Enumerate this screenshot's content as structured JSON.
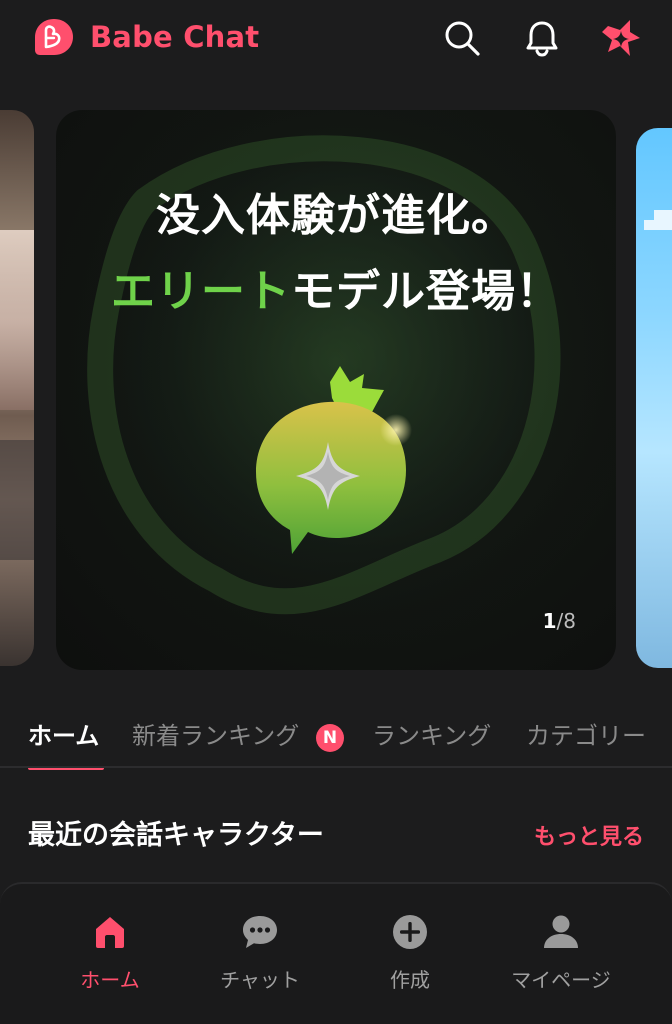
{
  "header": {
    "app_title": "Babe Chat",
    "logo_icon": "babe-chat-logo-icon",
    "search_icon": "search-icon",
    "notification_icon": "bell-icon",
    "elite_icon": "elite-sparkle-icon",
    "brand_color": "#ff4f6d"
  },
  "banner": {
    "line1": "没入体験が進化。",
    "line2_highlight": "エリート",
    "line2_rest": "モデル登場！",
    "highlight_color": "#6fd24a",
    "page_current": "1",
    "page_total": "/8",
    "mascot_icon": "elite-mascot-icon"
  },
  "tabs": [
    {
      "label": "ホーム",
      "active": true
    },
    {
      "label": "新着ランキング",
      "badge": "N"
    },
    {
      "label": "ランキング"
    },
    {
      "label": "カテゴリー"
    }
  ],
  "section": {
    "title": "最近の会話キャラクター",
    "more_label": "もっと見る"
  },
  "bottom_nav": [
    {
      "label": "ホーム",
      "icon": "home-icon",
      "active": true
    },
    {
      "label": "チャット",
      "icon": "chat-icon"
    },
    {
      "label": "作成",
      "icon": "plus-circle-icon"
    },
    {
      "label": "マイページ",
      "icon": "user-icon"
    }
  ]
}
